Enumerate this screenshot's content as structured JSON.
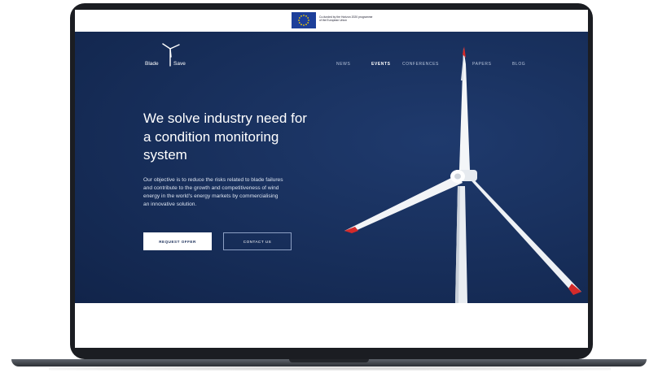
{
  "eu_banner": {
    "flag_icon": "eu-flag-icon",
    "text_line1": "Co-funded by the Horizon 2020 programme",
    "text_line2": "of the European Union"
  },
  "brand": {
    "logo_icon": "wind-turbine-icon",
    "name_left": "Blade",
    "name_right": "Save"
  },
  "nav": {
    "items": [
      {
        "label": "NEWS",
        "active": false
      },
      {
        "label": "EVENTS",
        "active": true
      },
      {
        "label": "CONFERENCES",
        "active": false
      },
      {
        "label": "PAPERS",
        "active": false
      },
      {
        "label": "BLOG",
        "active": false
      }
    ]
  },
  "hero": {
    "headline_lines": [
      "We solve industry need for",
      "a condition monitoring",
      "system"
    ],
    "body_lines": [
      "Our objective is to reduce the risks related to blade failures",
      "and contribute to the growth and competitiveness of wind",
      "energy in the world's energy markets by commercialising",
      "an innovative solution."
    ],
    "primary_button": "REQUEST OFFER",
    "secondary_button": "CONTACT US",
    "image_icon": "wind-turbine-photo"
  },
  "colors": {
    "hero_bg": "#172e5a",
    "blade_tip": "#d32a2a",
    "frame": "#1b1d22"
  }
}
